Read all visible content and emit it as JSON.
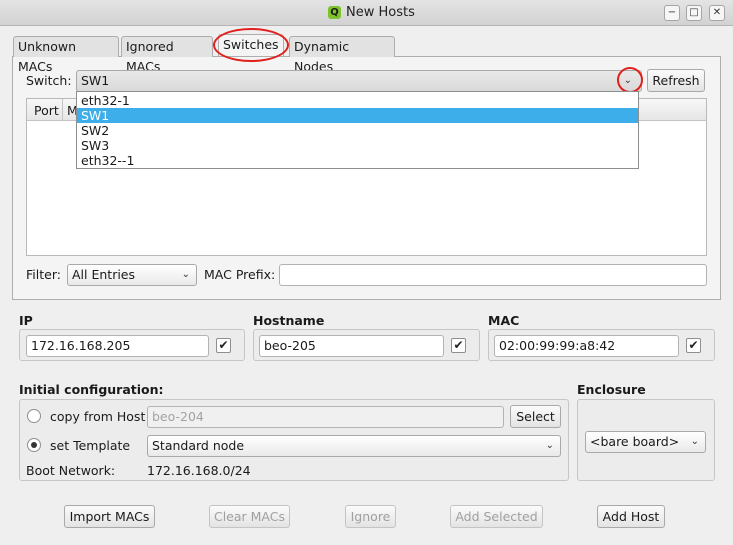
{
  "window": {
    "title": "New Hosts",
    "app_icon_glyph": "Q",
    "minimize_glyph": "−",
    "maximize_glyph": "□",
    "close_glyph": "✕"
  },
  "tabs": [
    {
      "label": "Unknown MACs"
    },
    {
      "label": "Ignored MACs"
    },
    {
      "label": "Switches",
      "active": true
    },
    {
      "label": "Dynamic Nodes"
    }
  ],
  "switches_panel": {
    "switch_label": "Switch:",
    "switch_value": "SW1",
    "refresh_label": "Refresh",
    "table_columns": [
      "Port",
      "M"
    ],
    "dropdown_options": [
      "eth32-1",
      "SW1",
      "SW2",
      "SW3",
      "eth32--1"
    ],
    "dropdown_selected": "SW1",
    "filter_label": "Filter:",
    "filter_value": "All Entries",
    "mac_prefix_label": "MAC Prefix:",
    "mac_prefix_value": ""
  },
  "host_fields": {
    "ip_label": "IP",
    "ip_value": "172.16.168.205",
    "ip_checked": true,
    "hostname_label": "Hostname",
    "hostname_value": "beo-205",
    "hostname_checked": true,
    "mac_label": "MAC",
    "mac_value": "02:00:99:99:a8:42",
    "mac_checked": true,
    "check_glyph": "✔"
  },
  "initial_config": {
    "section_label": "Initial configuration:",
    "copy_from_host_label": "copy from Host",
    "copy_from_host_value": "beo-204",
    "select_label": "Select",
    "set_template_label": "set Template",
    "template_value": "Standard node",
    "boot_network_label": "Boot Network:",
    "boot_network_value": "172.16.168.0/24",
    "selected_option": "set Template"
  },
  "enclosure": {
    "section_label": "Enclosure",
    "value": "<bare board>"
  },
  "bottom_buttons": [
    {
      "label": "Import MACs",
      "enabled": true
    },
    {
      "label": "Clear MACs",
      "enabled": false
    },
    {
      "label": "Ignore",
      "enabled": false
    },
    {
      "label": "Add Selected",
      "enabled": false
    },
    {
      "label": "Add Host",
      "enabled": true
    }
  ],
  "colors": {
    "highlight_ring": "#e0201c",
    "selection": "#3daee9",
    "app_icon": "#7ec32c"
  }
}
